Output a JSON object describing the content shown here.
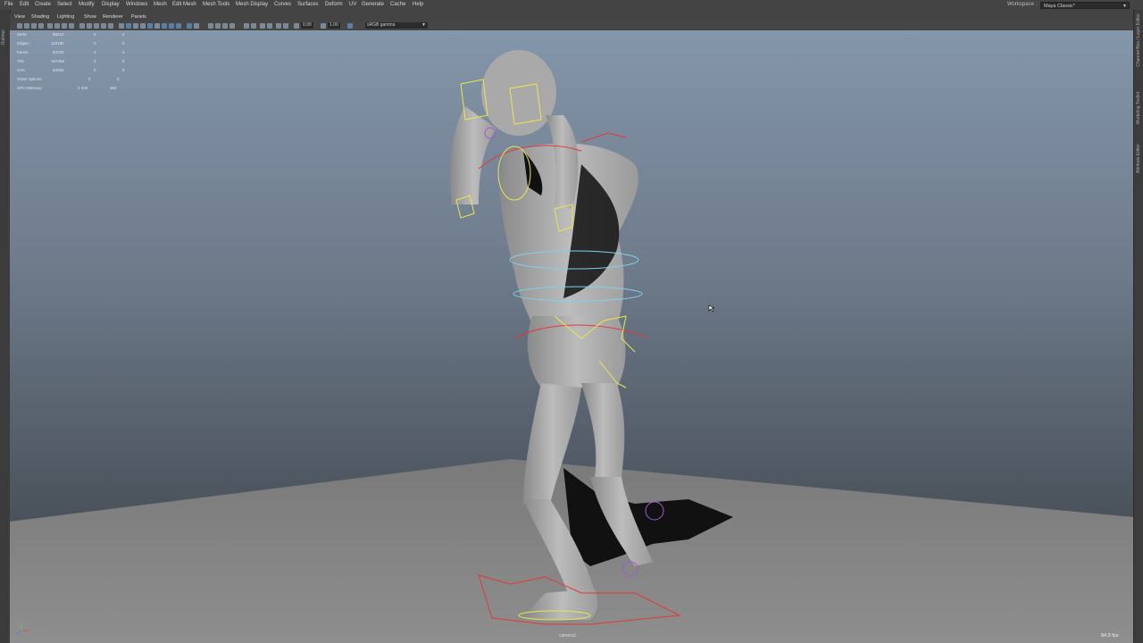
{
  "main_menu": [
    "File",
    "Edit",
    "Create",
    "Select",
    "Modify",
    "Display",
    "Windows",
    "Mesh",
    "Edit Mesh",
    "Mesh Tools",
    "Mesh Display",
    "Curves",
    "Surfaces",
    "Deform",
    "UV",
    "Generate",
    "Cache",
    "Help"
  ],
  "workspace": {
    "label": "Workspace :",
    "value": "Maya Classic*"
  },
  "left_strip": {
    "label": "Outliner"
  },
  "right_strip": [
    "Channel Box / Layer Editor",
    "Modeling Toolkit",
    "Attribute Editor"
  ],
  "panel_menu": [
    "View",
    "Shading",
    "Lighting",
    "Show",
    "Renderer",
    "Panels"
  ],
  "toolbar": {
    "exposure": "0.00",
    "gamma": "1.00",
    "color_space": "sRGB gamma"
  },
  "hud": {
    "rows": [
      {
        "label": "Verts:",
        "v1": "56412",
        "v2": "0",
        "v3": "0"
      },
      {
        "label": "Edges:",
        "v1": "110180",
        "v2": "0",
        "v3": "0"
      },
      {
        "label": "Faces:",
        "v1": "53700",
        "v2": "0",
        "v3": "0"
      },
      {
        "label": "Tris:",
        "v1": "107460",
        "v2": "0",
        "v3": "0"
      },
      {
        "label": "UVs:",
        "v1": "62094",
        "v2": "0",
        "v3": "0"
      },
      {
        "label": "XGen Splines:",
        "v1": "",
        "v2": "0",
        "v3": "0"
      },
      {
        "label": "GPU Memory:",
        "v1": "2 046",
        "v2": "",
        "v3": "354"
      }
    ]
  },
  "viewport": {
    "camera_label": "camera1",
    "fps": "84.9 fps"
  },
  "colors": {
    "ctrl_yellow": "#e8e84a",
    "ctrl_red": "#e03a3a",
    "ctrl_blue": "#7fd0e8",
    "ctrl_purple": "#a05ad0"
  }
}
